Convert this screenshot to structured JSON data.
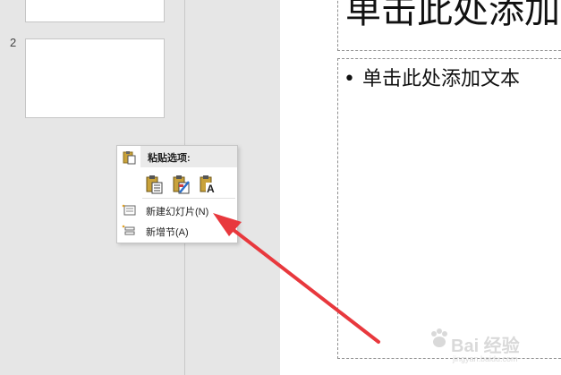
{
  "thumbnails": {
    "slides": [
      {
        "number": ""
      },
      {
        "number": "2"
      }
    ]
  },
  "slide": {
    "title_placeholder": "单击此处添加",
    "body_placeholder": "单击此处添加文本",
    "bullet": "•"
  },
  "context_menu": {
    "paste_header": "粘贴选项:",
    "paste_options": [
      {
        "name": "use-destination-theme",
        "icon": "clipboard-doc-icon"
      },
      {
        "name": "keep-source-formatting",
        "icon": "clipboard-brush-icon"
      },
      {
        "name": "keep-text-only",
        "icon": "clipboard-text-icon"
      }
    ],
    "items": [
      {
        "label": "新建幻灯片(N)",
        "icon": "new-slide-icon"
      },
      {
        "label": "新增节(A)",
        "icon": "new-section-icon"
      }
    ]
  },
  "annotation": {
    "arrow_color": "#e8383d"
  },
  "watermark": {
    "brand": "Bai 经验",
    "url": "jingyan.baidu.com"
  }
}
